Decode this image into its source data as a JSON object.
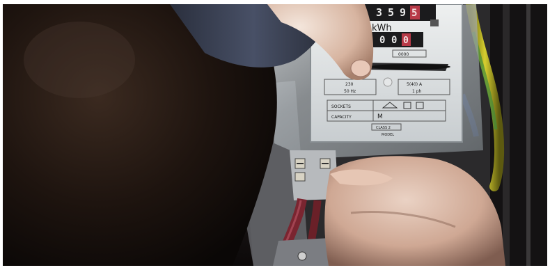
{
  "meter": {
    "top_digits": [
      "3",
      "5",
      "9",
      "5"
    ],
    "bottom_digits": [
      "0",
      "0",
      "0"
    ],
    "unit": "kWh",
    "small_label": "0000",
    "rating_left": "230",
    "rating_left_2": "50 Hz",
    "rating_right": "5(40) A",
    "rating_right_2": "1 ph",
    "row1_label": "SOCKETS",
    "row2_label": "CAPACITY",
    "row2_value": "M",
    "footer_1": "CLASS 2",
    "footer_2": "MODEL"
  },
  "colors": {
    "meter_face": "#d8dcdd",
    "wire_yellow": "#c8c020",
    "wire_green": "#3f8a3a",
    "wire_red": "#8a2a32",
    "skin": "#d9b8a4"
  }
}
